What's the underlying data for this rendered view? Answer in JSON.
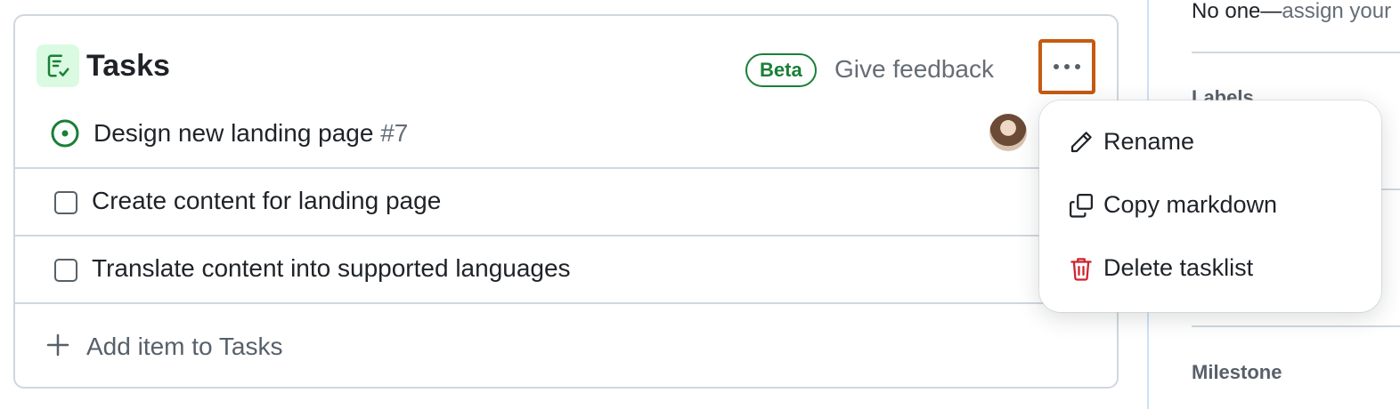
{
  "tasklist": {
    "title": "Tasks",
    "badge": "Beta",
    "feedback_link": "Give feedback",
    "more_icon": "kebab-horizontal-icon",
    "items": [
      {
        "title": "Design new landing page",
        "number": "#7",
        "type": "issue",
        "status": "open"
      },
      {
        "title": "Create content for landing page",
        "type": "draft",
        "checked": false
      },
      {
        "title": "Translate content into supported languages",
        "type": "draft",
        "checked": false
      }
    ],
    "add_item_label": "Add item to Tasks"
  },
  "menu": {
    "items": [
      {
        "label": "Rename",
        "icon": "pencil-icon"
      },
      {
        "label": "Copy markdown",
        "icon": "copy-icon"
      },
      {
        "label": "Delete tasklist",
        "icon": "trash-icon",
        "danger": true
      }
    ]
  },
  "sidebar": {
    "assignees_empty": "No one—",
    "assign_link": "assign your",
    "labels_heading": "Labels",
    "milestone_heading": "Milestone"
  },
  "colors": {
    "accent_green": "#1a7f37",
    "danger_red": "#cf222e",
    "highlight_border": "#c55a11",
    "muted_text": "#656d76"
  }
}
